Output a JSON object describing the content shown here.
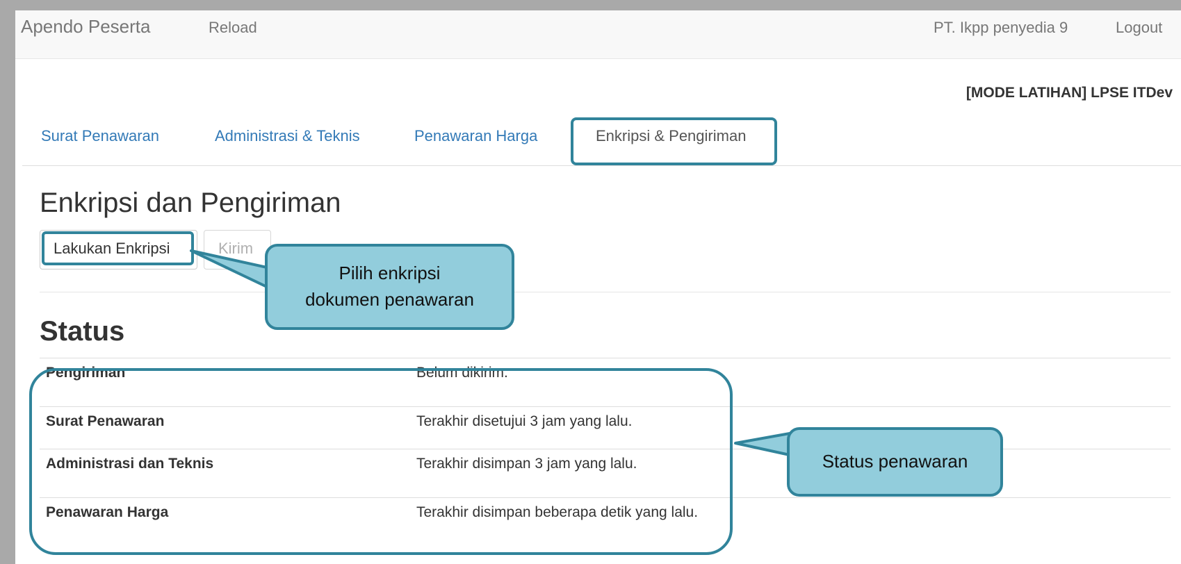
{
  "navbar": {
    "brand": "Apendo Peserta",
    "reload": "Reload",
    "user": "PT. Ikpp penyedia 9",
    "logout": "Logout"
  },
  "mode_title": "[MODE LATIHAN] LPSE ITDev",
  "tabs": [
    {
      "label": "Surat Penawaran"
    },
    {
      "label": "Administrasi & Teknis"
    },
    {
      "label": "Penawaran Harga"
    },
    {
      "label": "Enkripsi & Pengiriman"
    }
  ],
  "main": {
    "heading": "Enkripsi dan Pengiriman",
    "encrypt_button": "Lakukan Enkripsi",
    "send_button": "Kirim",
    "status_heading": "Status"
  },
  "status_rows": [
    {
      "label": "Pengiriman",
      "value": "Belum dikirim."
    },
    {
      "label": "Surat Penawaran",
      "value": "Terakhir disetujui 3 jam yang lalu."
    },
    {
      "label": "Administrasi dan Teknis",
      "value": "Terakhir disimpan 3 jam yang lalu."
    },
    {
      "label": "Penawaran Harga",
      "value": "Terakhir disimpan beberapa detik yang lalu."
    }
  ],
  "callouts": {
    "encrypt_line1": "Pilih enkripsi",
    "encrypt_line2": "dokumen penawaran",
    "status": "Status penawaran"
  },
  "colors": {
    "highlight": "#31849b",
    "callout_fill": "#92cddc",
    "link": "#337ab7"
  }
}
